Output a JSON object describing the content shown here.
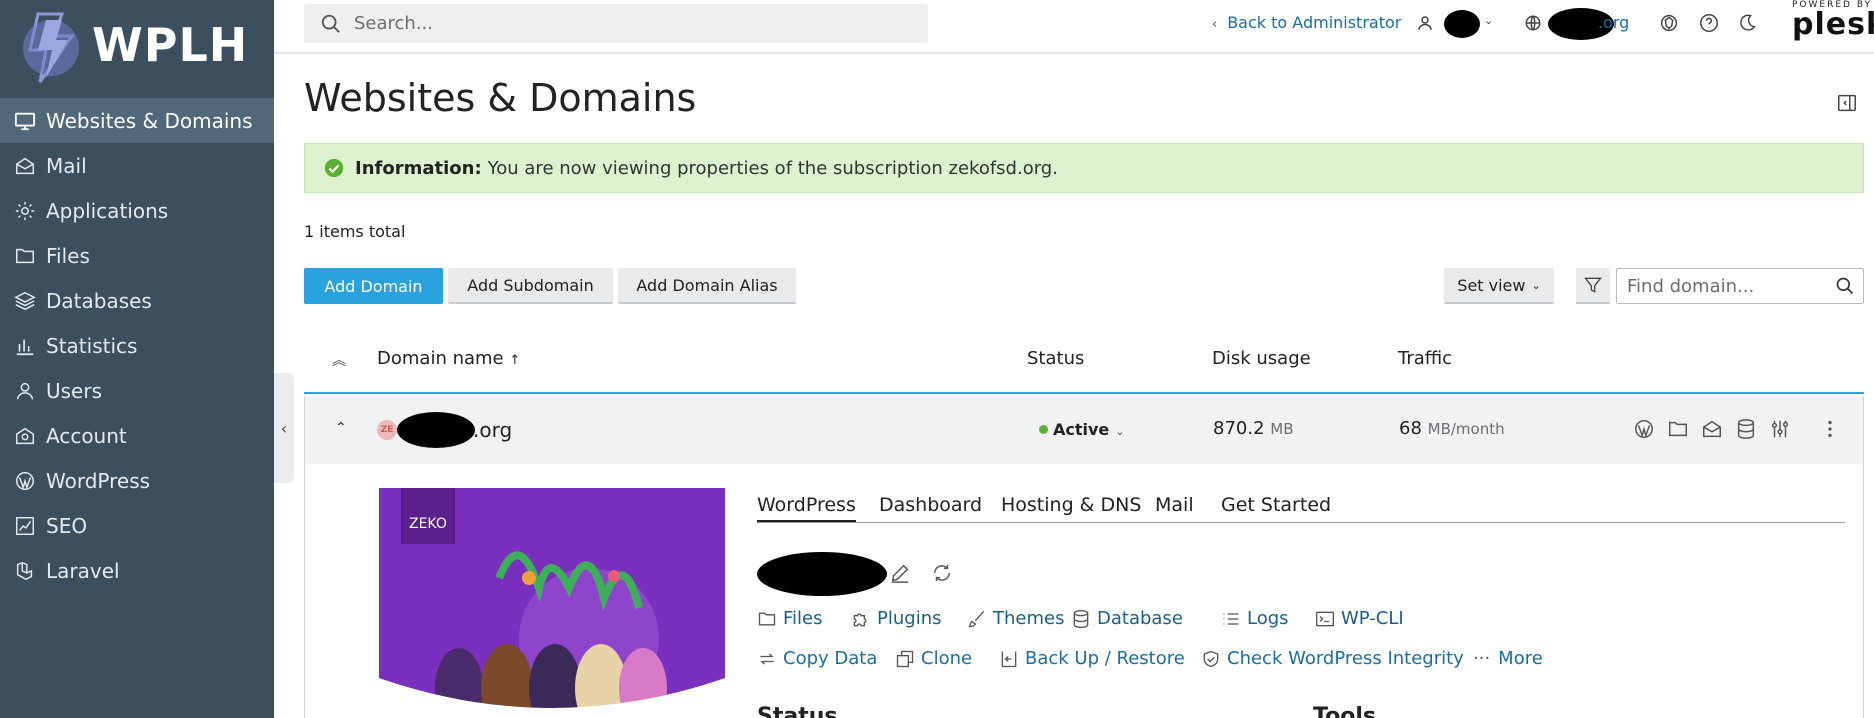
{
  "sidebar": {
    "logo_text": "WPLH",
    "items": [
      {
        "label": "Websites & Domains",
        "icon": "monitor-icon",
        "active": true
      },
      {
        "label": "Mail",
        "icon": "mail-icon"
      },
      {
        "label": "Applications",
        "icon": "gear-icon"
      },
      {
        "label": "Files",
        "icon": "folder-icon"
      },
      {
        "label": "Databases",
        "icon": "layers-icon"
      },
      {
        "label": "Statistics",
        "icon": "bar-chart-icon"
      },
      {
        "label": "Users",
        "icon": "user-icon"
      },
      {
        "label": "Account",
        "icon": "account-icon"
      },
      {
        "label": "WordPress",
        "icon": "wordpress-icon"
      },
      {
        "label": "SEO",
        "icon": "seo-chart-icon"
      },
      {
        "label": "Laravel",
        "icon": "laravel-icon"
      }
    ]
  },
  "topbar": {
    "search_placeholder": "Search...",
    "back_link": "Back to Administrator",
    "domain_suffix": ".org",
    "brand_powered": "POWERED BY",
    "brand_name": "plesk"
  },
  "page": {
    "title": "Websites & Domains",
    "info_label": "Information:",
    "info_message": "You are now viewing properties of the subscription zekofsd.org.",
    "items_total": "1 items total"
  },
  "toolbar": {
    "add_domain": "Add Domain",
    "add_subdomain": "Add Subdomain",
    "add_alias": "Add Domain Alias",
    "set_view": "Set view",
    "find_placeholder": "Find domain..."
  },
  "table": {
    "headers": {
      "domain": "Domain name",
      "sort_indicator": "↑",
      "status": "Status",
      "disk": "Disk usage",
      "traffic": "Traffic"
    },
    "row": {
      "favicon_text": "ZE",
      "domain_suffix": ".org",
      "status": "Active",
      "disk_value": "870.2",
      "disk_unit": "MB",
      "traffic_value": "68",
      "traffic_unit": "MB/month"
    }
  },
  "detail": {
    "tabs": [
      "WordPress",
      "Dashboard",
      "Hosting & DNS",
      "Mail",
      "Get Started"
    ],
    "primary_links": [
      "Files",
      "Plugins",
      "Themes",
      "Database",
      "Logs",
      "WP-CLI"
    ],
    "secondary_links": [
      "Copy Data",
      "Clone",
      "Back Up / Restore",
      "Check WordPress Integrity",
      "More"
    ],
    "section_status": "Status",
    "section_tools": "Tools",
    "preview_logo": "ZEKO"
  },
  "colors": {
    "sidebar_bg": "#3c4f5f",
    "sidebar_active": "#50687a",
    "primary_button": "#28a3e0",
    "link": "#1a6ea3",
    "info_bg": "#ddf3cf",
    "status_active": "#58b130",
    "preview_purple": "#7b2fbe"
  }
}
